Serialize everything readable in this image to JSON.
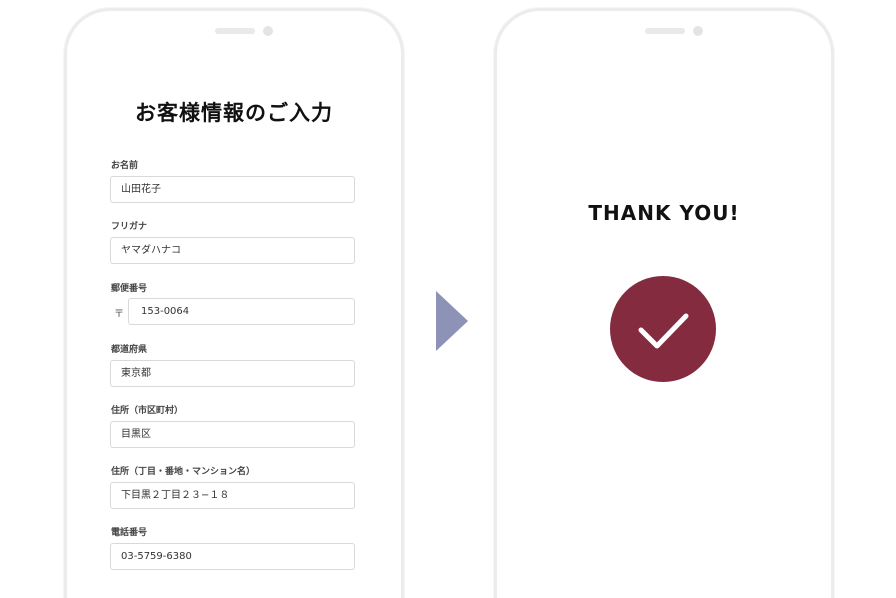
{
  "form_screen": {
    "title": "お客様情報のご入力",
    "postal_mark": "〒",
    "fields": [
      {
        "label": "お名前",
        "value": "山田花子"
      },
      {
        "label": "フリガナ",
        "value": "ヤマダハナコ"
      },
      {
        "label": "郵便番号",
        "value": "153-0064"
      },
      {
        "label": "都道府県",
        "value": "東京都"
      },
      {
        "label": "住所（市区町村）",
        "value": "目黒区"
      },
      {
        "label": "住所（丁目・番地・マンション名）",
        "value": "下目黒２丁目２３−１８"
      },
      {
        "label": "電話番号",
        "value": "03-5759-6380"
      }
    ]
  },
  "thanks_screen": {
    "title": "THANK YOU!"
  },
  "colors": {
    "arrow": "#8c93b7",
    "check_circle": "#842b40"
  },
  "icons": [
    "arrow-right-icon",
    "checkmark-icon",
    "postal-mark-icon"
  ]
}
